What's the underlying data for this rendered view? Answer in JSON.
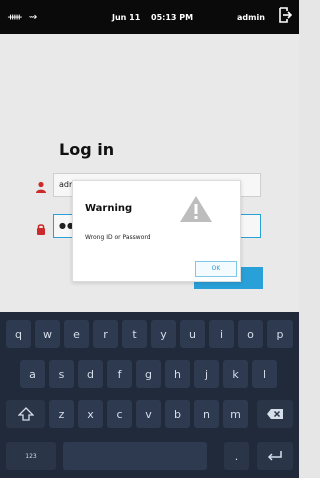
{
  "status_bar": {
    "left_icons": "ᚔ ⇝",
    "date": "Jun 11",
    "time": "05:13 PM",
    "user": "admin"
  },
  "login": {
    "title": "Log in",
    "username_value": "admin",
    "password_dots": "●●●"
  },
  "dialog": {
    "title": "Warning",
    "message": "Wrong ID or Password",
    "ok_label": "OK"
  },
  "keyboard": {
    "row1": [
      "q",
      "w",
      "e",
      "r",
      "t",
      "y",
      "u",
      "i",
      "o",
      "p"
    ],
    "row2": [
      "a",
      "s",
      "d",
      "f",
      "g",
      "h",
      "j",
      "k",
      "l"
    ],
    "row3": [
      "z",
      "x",
      "c",
      "v",
      "b",
      "n",
      "m"
    ],
    "numbers_label": "123",
    "period_label": "."
  },
  "colors": {
    "status_bar_bg": "#0a0a0a",
    "accent_red": "#cc2a2a",
    "accent_blue": "#2aa0d8",
    "keyboard_bg": "#202a3a"
  }
}
